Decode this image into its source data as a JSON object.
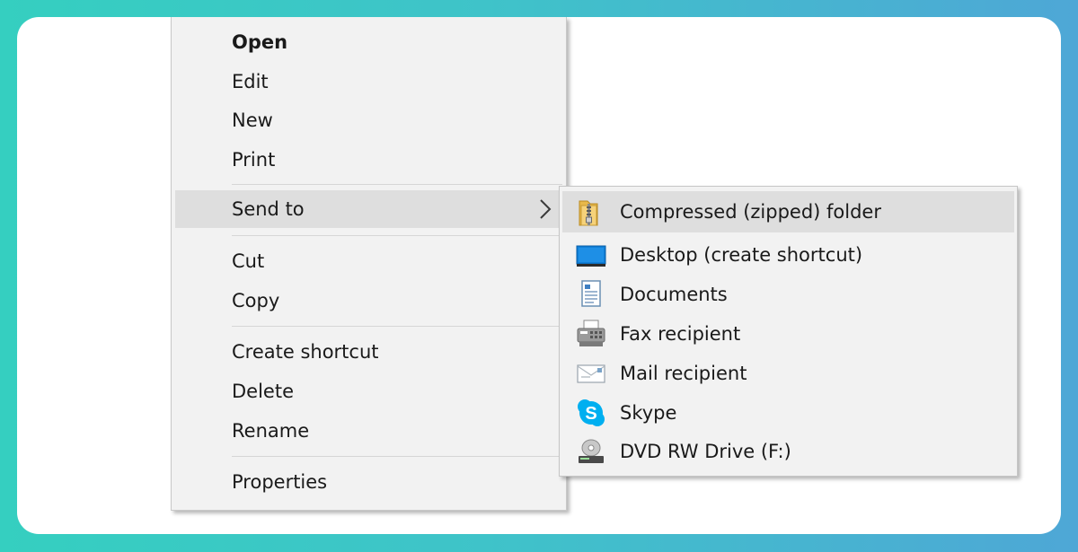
{
  "context_menu": {
    "items": [
      {
        "label": "Open"
      },
      {
        "label": "Edit"
      },
      {
        "label": "New"
      },
      {
        "label": "Print"
      },
      {
        "label": "Send to"
      },
      {
        "label": "Cut"
      },
      {
        "label": "Copy"
      },
      {
        "label": "Create shortcut"
      },
      {
        "label": "Delete"
      },
      {
        "label": "Rename"
      },
      {
        "label": "Properties"
      }
    ],
    "highlighted": "Send to",
    "submenu_arrow_icon": "chevron-right-icon"
  },
  "send_to_submenu": {
    "items": [
      {
        "label": "Compressed (zipped) folder",
        "icon": "zip-folder-icon"
      },
      {
        "label": "Desktop (create shortcut)",
        "icon": "desktop-icon"
      },
      {
        "label": "Documents",
        "icon": "documents-icon"
      },
      {
        "label": "Fax recipient",
        "icon": "fax-icon"
      },
      {
        "label": "Mail recipient",
        "icon": "mail-icon"
      },
      {
        "label": "Skype",
        "icon": "skype-icon"
      },
      {
        "label": "DVD RW Drive (F:)",
        "icon": "dvd-drive-icon"
      }
    ],
    "highlighted": "Compressed (zipped) folder"
  },
  "colors": {
    "background_gradient_start": "#35cfc0",
    "background_gradient_end": "#4ea7d6",
    "menu_background": "#f2f2f2",
    "highlight": "#dedede",
    "skype_blue": "#00aff0",
    "desktop_blue": "#0078d7"
  }
}
